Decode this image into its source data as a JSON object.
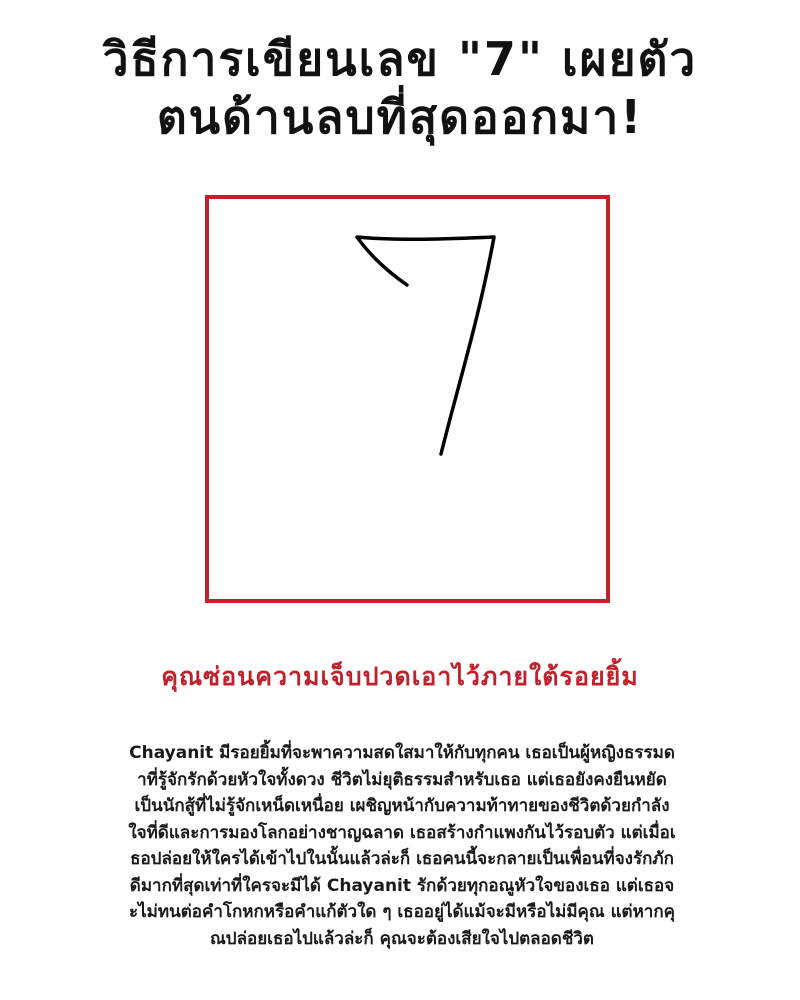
{
  "title": {
    "line1": "วิธีการเขียนเลข \"7\" เผยตัว",
    "line2": "ตนด้านลบที่สุดออกมา!"
  },
  "drawing": {
    "digit": "7",
    "frame_color": "#c0222b"
  },
  "subtitle": {
    "text": "คุณซ่อนความเจ็บปวดเอาไว้ภายใต้รอยยิ้ม",
    "color": "#c0222b"
  },
  "body": {
    "lines": [
      "Chayanit มีรอยยิ้มที่จะพาความสดใสมาให้กับทุกคน เธอเป็นผู้หญิงธรรมด",
      "าที่รู้จักรักด้วยหัวใจทั้งดวง ชีวิตไม่ยุติธรรมสำหรับเธอ แต่เธอยังคงยืนหยัด",
      "เป็นนักสู้ที่ไม่รู้จักเหน็ดเหนื่อย เผชิญหน้ากับความท้าทายของชีวิตด้วยกำลัง",
      "ใจที่ดีและการมองโลกอย่างชาญฉลาด เธอสร้างกำแพงกันไว้รอบตัว แต่เมื่อเ",
      "ธอปล่อยให้ใครได้เข้าไปในนั้นแล้วล่ะก็ เธอคนนี้จะกลายเป็นเพื่อนที่จงรักภัก",
      "ดีมากที่สุดเท่าที่ใครจะมีได้ Chayanit รักด้วยทุกอณูหัวใจของเธอ แต่เธอจ",
      "ะไม่ทนต่อคำโกหกหรือคำแก้ตัวใด ๆ เธออยู่ได้แม้จะมีหรือไม่มีคุณ แต่หากคุ",
      "ณปล่อยเธอไปแล้วล่ะก็ คุณจะต้องเสียใจไปตลอดชีวิต"
    ]
  }
}
